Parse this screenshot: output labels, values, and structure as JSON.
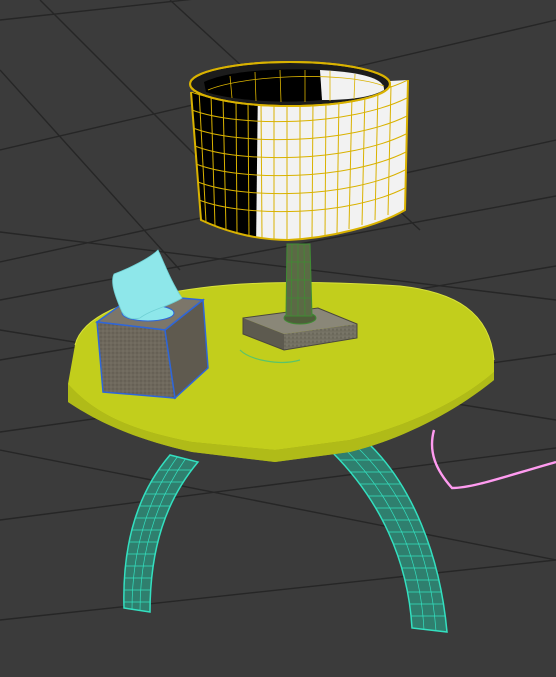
{
  "viewport": {
    "background": "#3b3b3b",
    "grid_color": "#262626"
  },
  "scene": {
    "objects": [
      {
        "name": "lamp-shade",
        "render": "wireframe-on-shaded",
        "colors": [
          "#f2f2f2",
          "#000000"
        ],
        "wire_color": "#d9b200"
      },
      {
        "name": "lamp-stem",
        "render": "wireframe-on-shaded",
        "color": "#5b6a45",
        "wire_color": "#3f8c33"
      },
      {
        "name": "lamp-base",
        "render": "shaded",
        "color": "#737062"
      },
      {
        "name": "tissue-box",
        "render": "shaded",
        "color": "#6e685c",
        "edge_color": "#2f66d8"
      },
      {
        "name": "tissue",
        "render": "shaded",
        "color": "#8ee7ea"
      },
      {
        "name": "table-top",
        "render": "shaded",
        "color": "#c2ce1c"
      },
      {
        "name": "table-legs",
        "render": "wireframe",
        "color": "#33e0c0"
      },
      {
        "name": "power-cord",
        "render": "spline",
        "color": "#ff9bf0"
      }
    ]
  }
}
